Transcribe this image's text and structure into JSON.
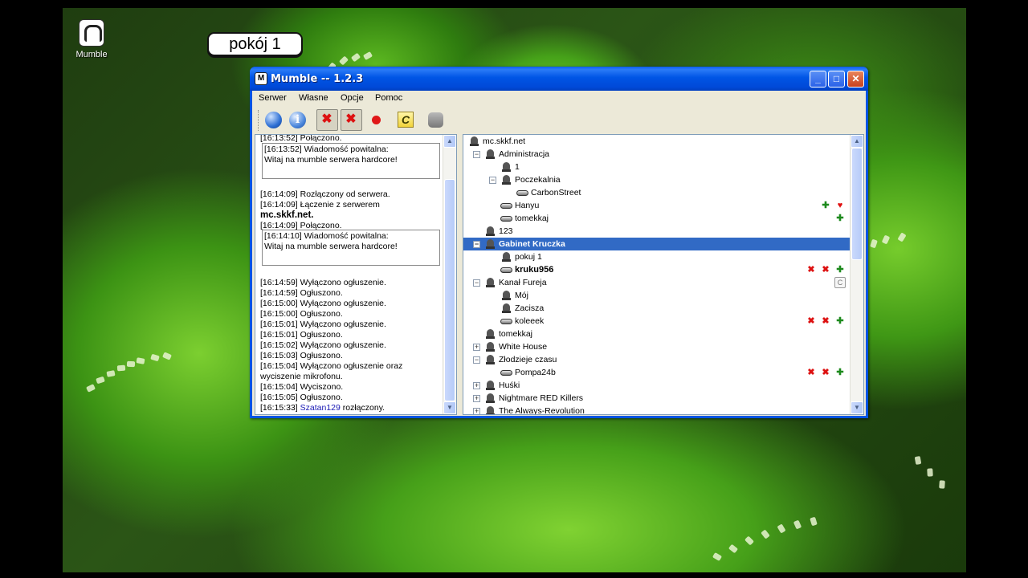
{
  "desktop": {
    "icon_label": "Mumble"
  },
  "window": {
    "title": "Mumble -- 1.2.3",
    "minimize": "_",
    "maximize": "□",
    "close": "✕"
  },
  "menu": [
    "Serwer",
    "Własne",
    "Opcje",
    "Pomoc"
  ],
  "toolbar_icons": [
    "globe-icon",
    "info-icon",
    "mute-self-icon",
    "deafen-self-icon",
    "record-icon",
    "comment-icon",
    "user-settings-icon"
  ],
  "callout": "pokój 1",
  "log": {
    "lines_a": [
      {
        "t": "[16:13:52] Połączono."
      }
    ],
    "welcome1": {
      "t": "[16:13:52] Wiadomość powitalna:",
      "m": "Witaj na mumble serwera hardcore!"
    },
    "lines_b": [
      {
        "t": "[16:14:09] Rozłączony od serwera."
      },
      {
        "t": "[16:14:09] Łączenie z serwerem"
      },
      {
        "t": "mc.skkf.net."
      },
      {
        "t": "[16:14:09] Połączono."
      }
    ],
    "welcome2": {
      "t": "[16:14:10] Wiadomość powitalna:",
      "m": "Witaj na mumble serwera hardcore!"
    },
    "lines_c": [
      {
        "t": "[16:14:59] Wyłączono ogłuszenie."
      },
      {
        "t": "[16:14:59] Ogłuszono."
      },
      {
        "t": "[16:15:00] Wyłączono ogłuszenie."
      },
      {
        "t": "[16:15:00] Ogłuszono."
      },
      {
        "t": "[16:15:01] Wyłączono ogłuszenie."
      },
      {
        "t": "[16:15:01] Ogłuszono."
      },
      {
        "t": "[16:15:02] Wyłączono ogłuszenie."
      },
      {
        "t": "[16:15:03] Ogłuszono."
      },
      {
        "t": "[16:15:04] Wyłączono ogłuszenie oraz"
      },
      {
        "t": "wyciszenie mikrofonu."
      },
      {
        "t": "[16:15:04] Wyciszono."
      },
      {
        "t": "[16:15:05] Ogłuszono."
      }
    ],
    "last": {
      "time": "[16:15:33]",
      "user": "Szatan129",
      "rest": "rozłączony."
    }
  },
  "tree": [
    {
      "label": "mc.skkf.net",
      "kind": "channel",
      "depth": 0,
      "exp": ""
    },
    {
      "label": "Administracja",
      "kind": "channel",
      "depth": 1,
      "exp": "−"
    },
    {
      "label": "1",
      "kind": "channel",
      "depth": 2,
      "exp": ""
    },
    {
      "label": "Poczekalnia",
      "kind": "channel",
      "depth": 2,
      "exp": "−"
    },
    {
      "label": "CarbonStreet",
      "kind": "user",
      "depth": 3,
      "exp": ""
    },
    {
      "label": "Hanyu",
      "kind": "user",
      "depth": 2,
      "exp": "",
      "icons": [
        "friend",
        "heart"
      ]
    },
    {
      "label": "tomekkaj",
      "kind": "user",
      "depth": 2,
      "exp": "",
      "icons": [
        "friend"
      ]
    },
    {
      "label": "123",
      "kind": "channel",
      "depth": 1,
      "exp": ""
    },
    {
      "label": "Gabinet Kruczka",
      "kind": "channel",
      "depth": 1,
      "exp": "−",
      "selected": true
    },
    {
      "label": "pokuj 1",
      "kind": "channel",
      "depth": 2,
      "exp": ""
    },
    {
      "label": "kruku956",
      "kind": "user",
      "depth": 2,
      "exp": "",
      "bold": true,
      "icons": [
        "mute",
        "deaf",
        "friend"
      ],
      "icons2": [
        "comment"
      ]
    },
    {
      "label": "Kanał Fureja",
      "kind": "channel",
      "depth": 1,
      "exp": "−"
    },
    {
      "label": "Mój",
      "kind": "channel",
      "depth": 2,
      "exp": ""
    },
    {
      "label": "Zacisza",
      "kind": "channel",
      "depth": 2,
      "exp": ""
    },
    {
      "label": "koleeek",
      "kind": "user",
      "depth": 2,
      "exp": "",
      "icons": [
        "mute",
        "deaf",
        "friend"
      ]
    },
    {
      "label": "tomekkaj",
      "kind": "channel",
      "depth": 1,
      "exp": ""
    },
    {
      "label": "White House",
      "kind": "channel",
      "depth": 1,
      "exp": "+"
    },
    {
      "label": "Złodzieje czasu",
      "kind": "channel",
      "depth": 1,
      "exp": "−"
    },
    {
      "label": "Pompa24b",
      "kind": "user",
      "depth": 2,
      "exp": "",
      "icons": [
        "mute",
        "deaf",
        "friend"
      ]
    },
    {
      "label": "Huśki",
      "kind": "channel",
      "depth": 1,
      "exp": "+"
    },
    {
      "label": "Nightmare RED Killers",
      "kind": "channel",
      "depth": 1,
      "exp": "+"
    },
    {
      "label": "The Always-Revolution",
      "kind": "channel",
      "depth": 1,
      "exp": "+"
    }
  ],
  "icon_glyphs": {
    "mute": "✖",
    "deaf": "✖",
    "friend": "✚",
    "heart": "♥",
    "comment": "C"
  },
  "scroll_arrows": {
    "up": "▲",
    "down": "▼"
  }
}
